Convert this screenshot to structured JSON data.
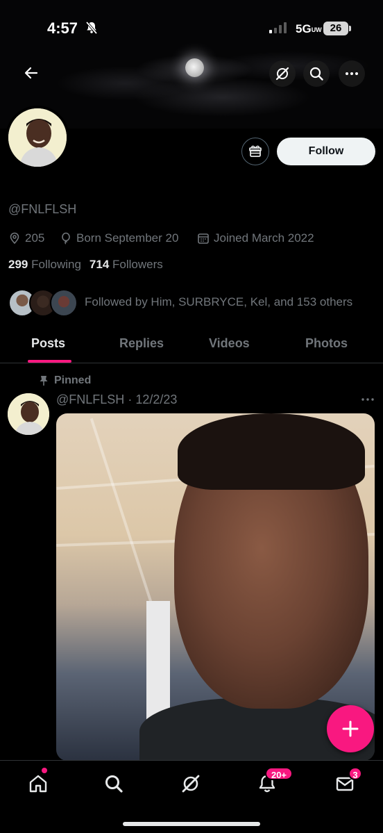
{
  "status_bar": {
    "time": "4:57",
    "network": "5G",
    "network_suffix": "UW",
    "battery": "26"
  },
  "header": {
    "back_icon": "arrow-left-icon",
    "grok_icon": "grok-icon",
    "search_icon": "search-icon",
    "more_icon": "more-horizontal-icon"
  },
  "profile": {
    "handle": "@FNLFLSH",
    "location": "205",
    "born": "Born September 20",
    "joined": "Joined March 2022",
    "following_count": "299",
    "following_label": "Following",
    "followers_count": "714",
    "followers_label": "Followers",
    "followed_by": "Followed by Him, SURBRYCE, Kel, and 153 others",
    "follow_button": "Follow"
  },
  "tabs": [
    {
      "label": "Posts",
      "active": true
    },
    {
      "label": "Replies",
      "active": false
    },
    {
      "label": "Videos",
      "active": false
    },
    {
      "label": "Photos",
      "active": false
    }
  ],
  "post": {
    "pinned_label": "Pinned",
    "handle": "@FNLFLSH",
    "separator": "·",
    "date": "12/2/23"
  },
  "bottom_nav": {
    "notifications_badge": "20+",
    "messages_badge": "3"
  },
  "colors": {
    "accent": "#f91880",
    "muted": "#71767b",
    "text": "#e7e9ea",
    "background": "#000000"
  }
}
